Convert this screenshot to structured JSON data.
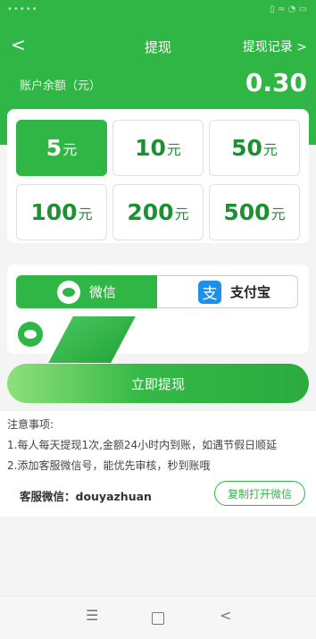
{
  "statusbar": {
    "left": "•••••",
    "right": "▯ ≈ ◔ ▭"
  },
  "header": {
    "back": "<",
    "title": "提现",
    "record": "提现记录",
    "record_arrow": ">",
    "balance_label": "账户余额（元）",
    "balance_value": "0.30"
  },
  "amounts": [
    {
      "num": "5",
      "unit": "元",
      "selected": true
    },
    {
      "num": "10",
      "unit": "元",
      "selected": false
    },
    {
      "num": "50",
      "unit": "元",
      "selected": false
    },
    {
      "num": "100",
      "unit": "元",
      "selected": false
    },
    {
      "num": "200",
      "unit": "元",
      "selected": false
    },
    {
      "num": "500",
      "unit": "元",
      "selected": false
    }
  ],
  "pay": {
    "wechat_label": "微信",
    "alipay_label": "支付宝",
    "alipay_glyph": "支"
  },
  "submit_label": "立即提现",
  "notes": {
    "heading": "注意事项:",
    "line1": "1.每人每天提现1次,金额24小时内到账，如遇节假日顺延",
    "line2": "2.添加客服微信号，能优先审核，秒到账哦",
    "service": "客服微信：douyazhuan",
    "copy_button": "复制打开微信"
  },
  "navbar": {
    "menu": "☰",
    "back": "<"
  },
  "colors": {
    "brand_green": "#2fb644",
    "alipay_blue": "#1e90e8"
  }
}
